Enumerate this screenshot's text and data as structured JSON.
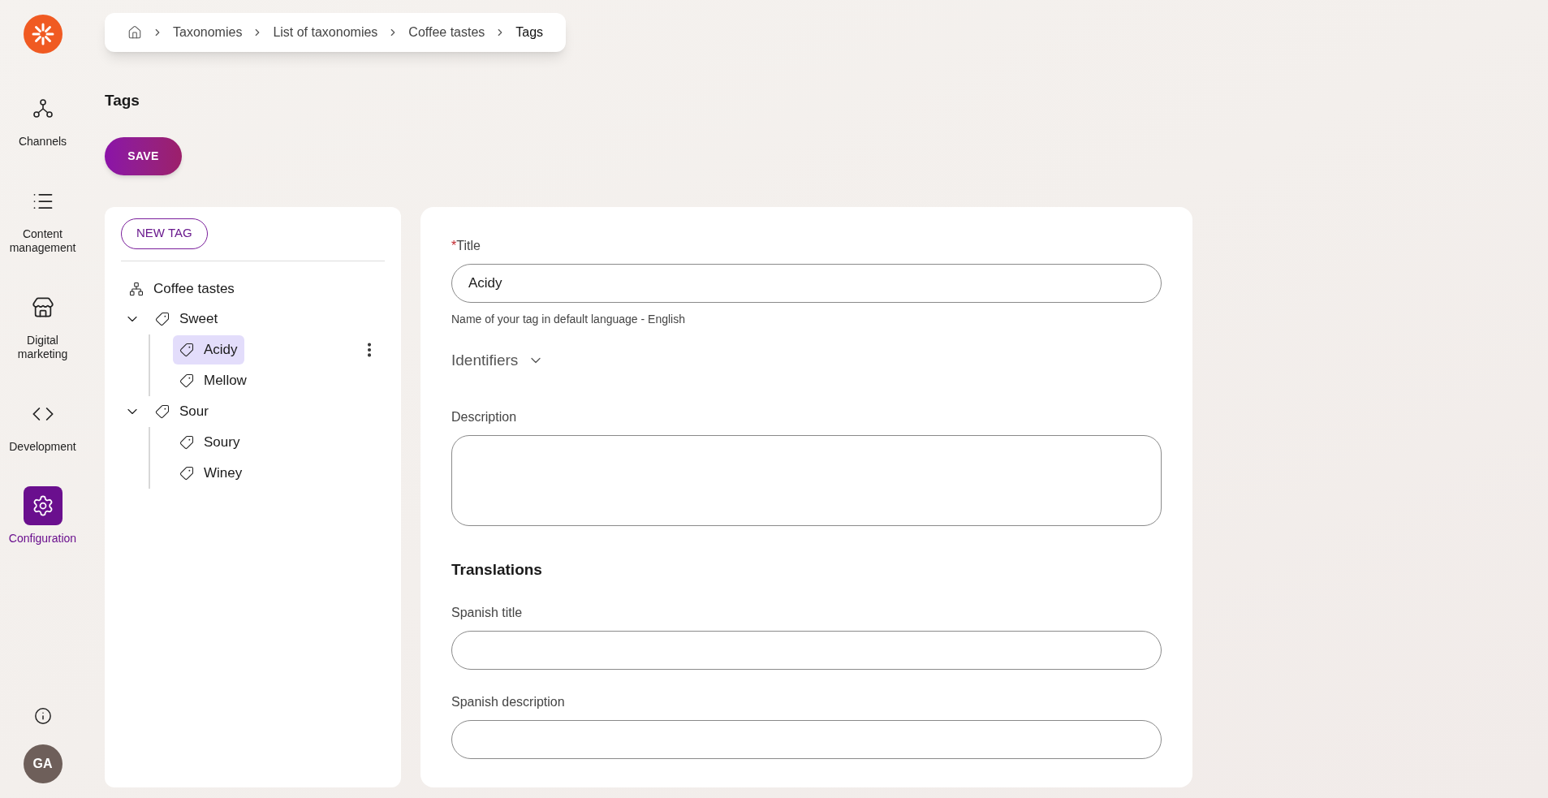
{
  "sidebar": {
    "items": [
      {
        "kind": "channels",
        "label": "Channels",
        "selected": false
      },
      {
        "kind": "content",
        "label": "Content management",
        "selected": false
      },
      {
        "kind": "marketing",
        "label": "Digital marketing",
        "selected": false
      },
      {
        "kind": "development",
        "label": "Development",
        "selected": false
      },
      {
        "kind": "configuration",
        "label": "Configuration",
        "selected": true
      }
    ],
    "avatar": "GA"
  },
  "breadcrumb": [
    "Taxonomies",
    "List of taxonomies",
    "Coffee tastes",
    "Tags"
  ],
  "page_title": "Tags",
  "save_button": "SAVE",
  "tree": {
    "new_button": "NEW TAG",
    "root": "Coffee tastes",
    "items": [
      {
        "label": "Sweet",
        "expanded": true,
        "selected": false,
        "children": [
          {
            "label": "Acidy",
            "selected": true
          },
          {
            "label": "Mellow",
            "selected": false
          }
        ]
      },
      {
        "label": "Sour",
        "expanded": true,
        "selected": false,
        "children": [
          {
            "label": "Soury",
            "selected": false
          },
          {
            "label": "Winey",
            "selected": false
          }
        ]
      }
    ]
  },
  "form": {
    "title_field": {
      "required_mark": "*",
      "label": "Title",
      "value": "Acidy",
      "help": "Name of your tag in default language - English"
    },
    "identifiers": {
      "label": "Identifiers",
      "expanded": false
    },
    "description": {
      "label": "Description"
    },
    "translations_heading": "Translations",
    "translation_fields": [
      {
        "label": "Spanish title"
      },
      {
        "label": "Spanish description"
      }
    ]
  }
}
